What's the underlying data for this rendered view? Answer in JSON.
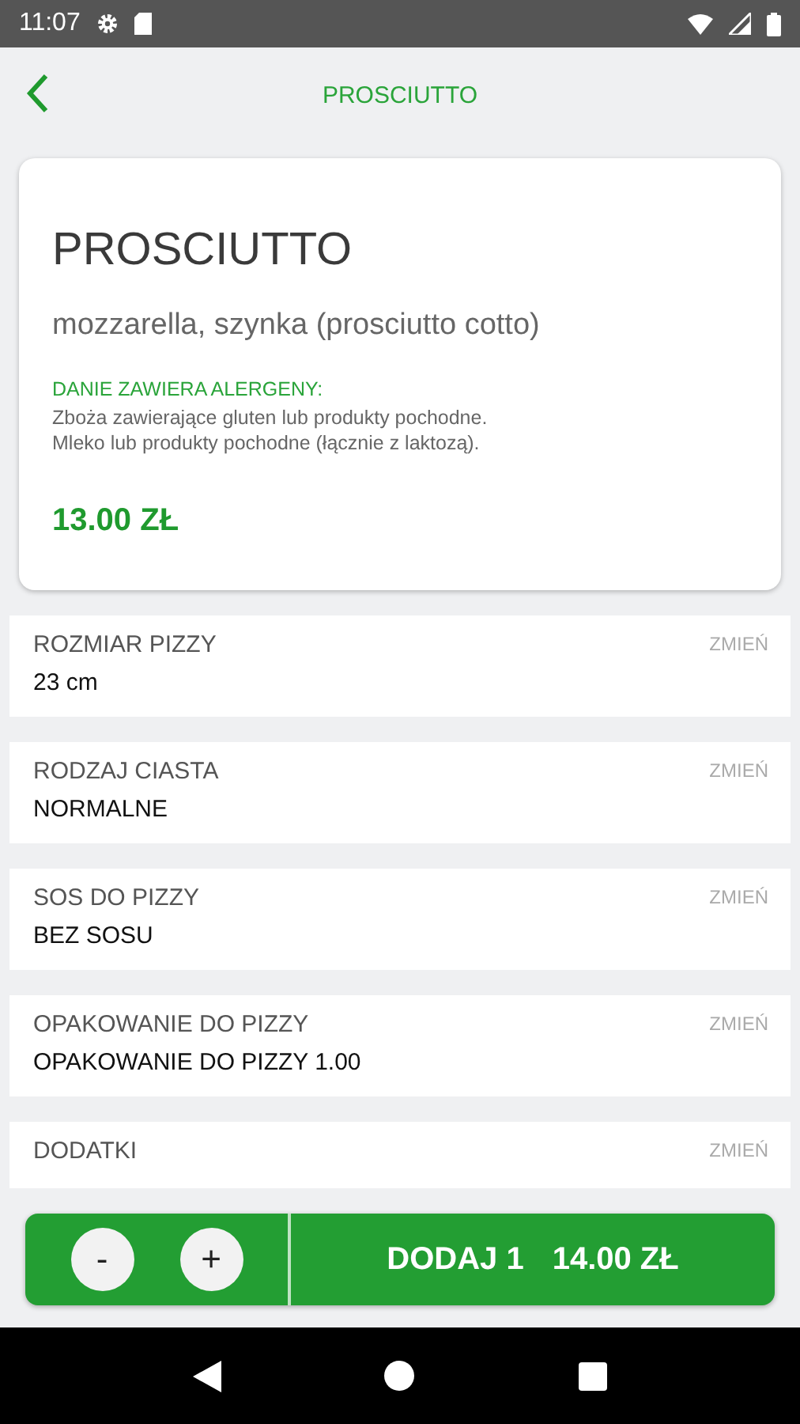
{
  "status_bar": {
    "time": "11:07"
  },
  "app_bar": {
    "title": "PROSCIUTTO"
  },
  "product": {
    "name": "PROSCIUTTO",
    "ingredients": "mozzarella, szynka (prosciutto cotto)",
    "allergens_heading": "DANIE ZAWIERA ALERGENY:",
    "allergens": [
      "Zboża zawierające gluten lub produkty pochodne.",
      "Mleko lub produkty pochodne (łącznie z laktozą)."
    ],
    "price": "13.00 ZŁ"
  },
  "options": [
    {
      "title": "ROZMIAR PIZZY",
      "value": "23 cm",
      "action": "ZMIEŃ"
    },
    {
      "title": "RODZAJ CIASTA",
      "value": "NORMALNE",
      "action": "ZMIEŃ"
    },
    {
      "title": "SOS DO PIZZY",
      "value": "BEZ SOSU",
      "action": "ZMIEŃ"
    },
    {
      "title": "OPAKOWANIE DO PIZZY",
      "value": "OPAKOWANIE DO PIZZY 1.00",
      "action": "ZMIEŃ"
    },
    {
      "title": "DODATKI",
      "action": "ZMIEŃ"
    }
  ],
  "order_bar": {
    "minus": "-",
    "plus": "+",
    "add_label": "DODAJ 1",
    "total": "14.00 ZŁ"
  }
}
